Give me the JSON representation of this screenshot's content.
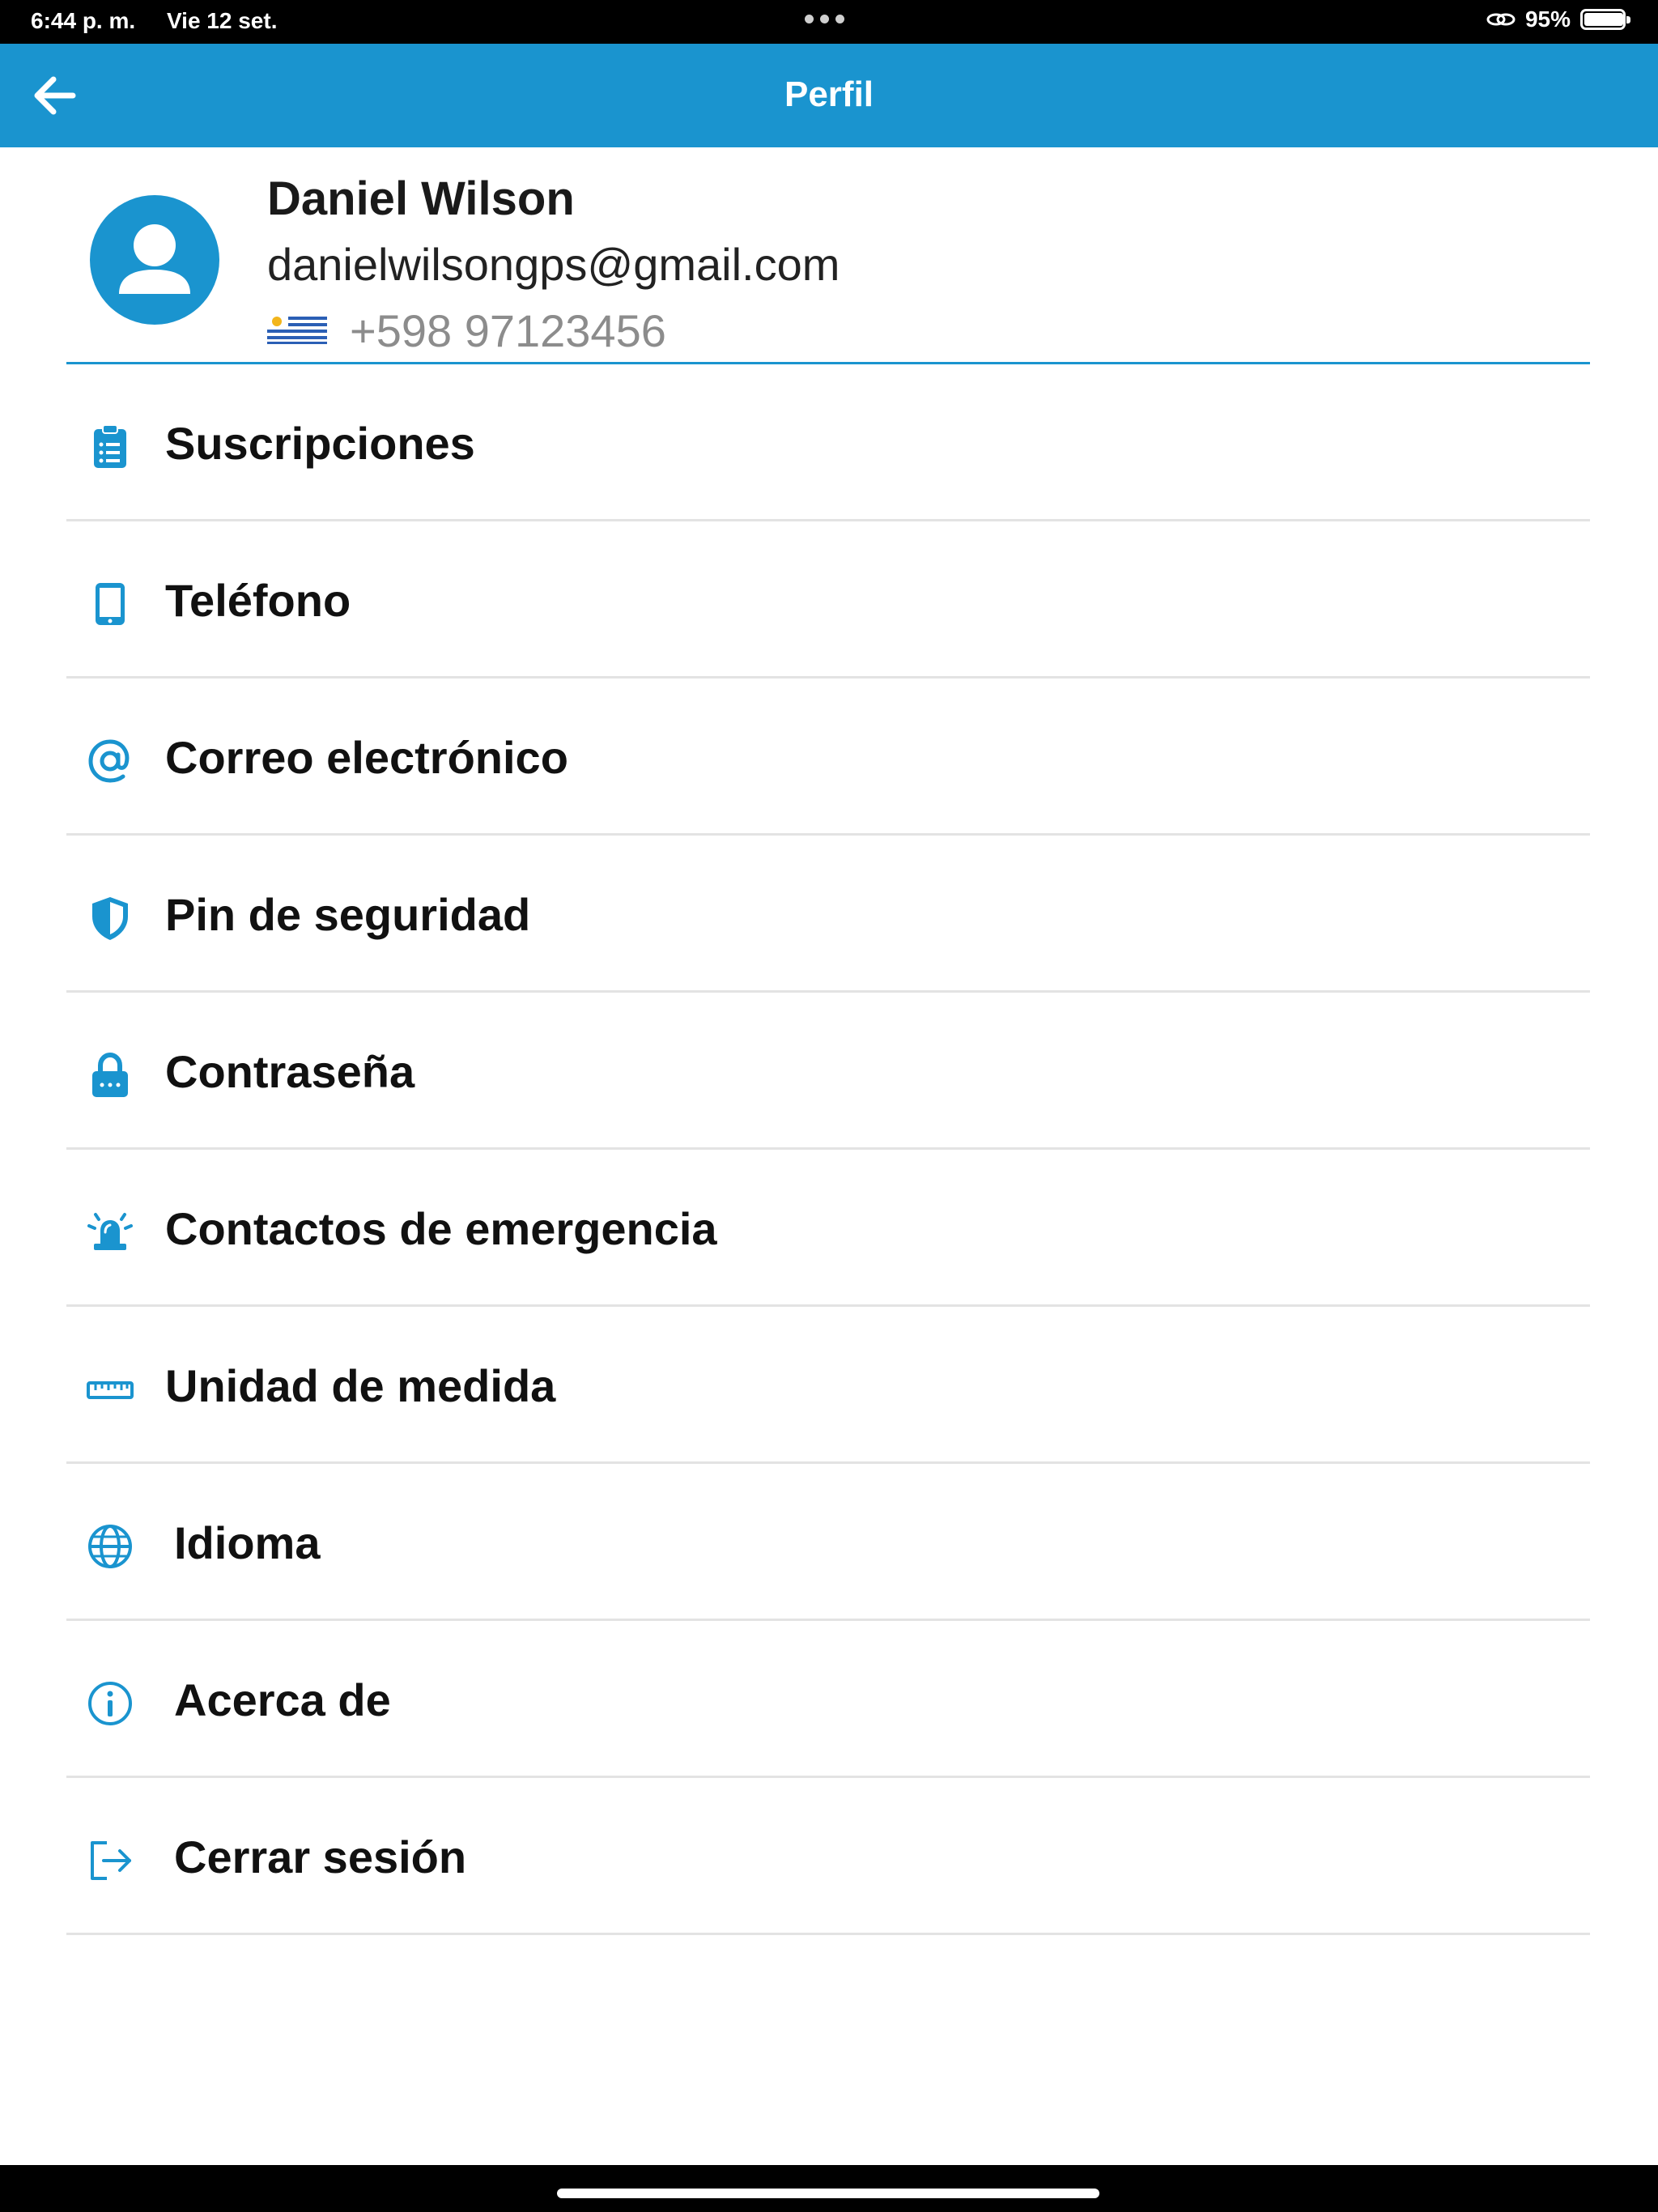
{
  "status_bar": {
    "time": "6:44 p. m.",
    "date": "Vie 12 set.",
    "battery": "95%"
  },
  "header": {
    "title": "Perfil",
    "back_icon": "arrow-left-icon",
    "color": "#1a94cf"
  },
  "profile": {
    "name": "Daniel Wilson",
    "email": "danielwilsongps@gmail.com",
    "phone": "+598 97123456",
    "flag": "uruguay-flag-icon"
  },
  "menu": {
    "items": [
      {
        "label": "Suscripciones",
        "icon": "clipboard-list-icon"
      },
      {
        "label": "Teléfono",
        "icon": "tablet-icon"
      },
      {
        "label": "Correo electrónico",
        "icon": "at-sign-icon"
      },
      {
        "label": "Pin de seguridad",
        "icon": "shield-icon"
      },
      {
        "label": "Contraseña",
        "icon": "lock-icon"
      },
      {
        "label": "Contactos de emergencia",
        "icon": "siren-icon"
      },
      {
        "label": "Unidad de medida",
        "icon": "ruler-icon"
      },
      {
        "label": "Idioma",
        "icon": "globe-icon"
      },
      {
        "label": "Acerca de",
        "icon": "info-icon"
      },
      {
        "label": "Cerrar sesión",
        "icon": "logout-icon"
      }
    ]
  }
}
